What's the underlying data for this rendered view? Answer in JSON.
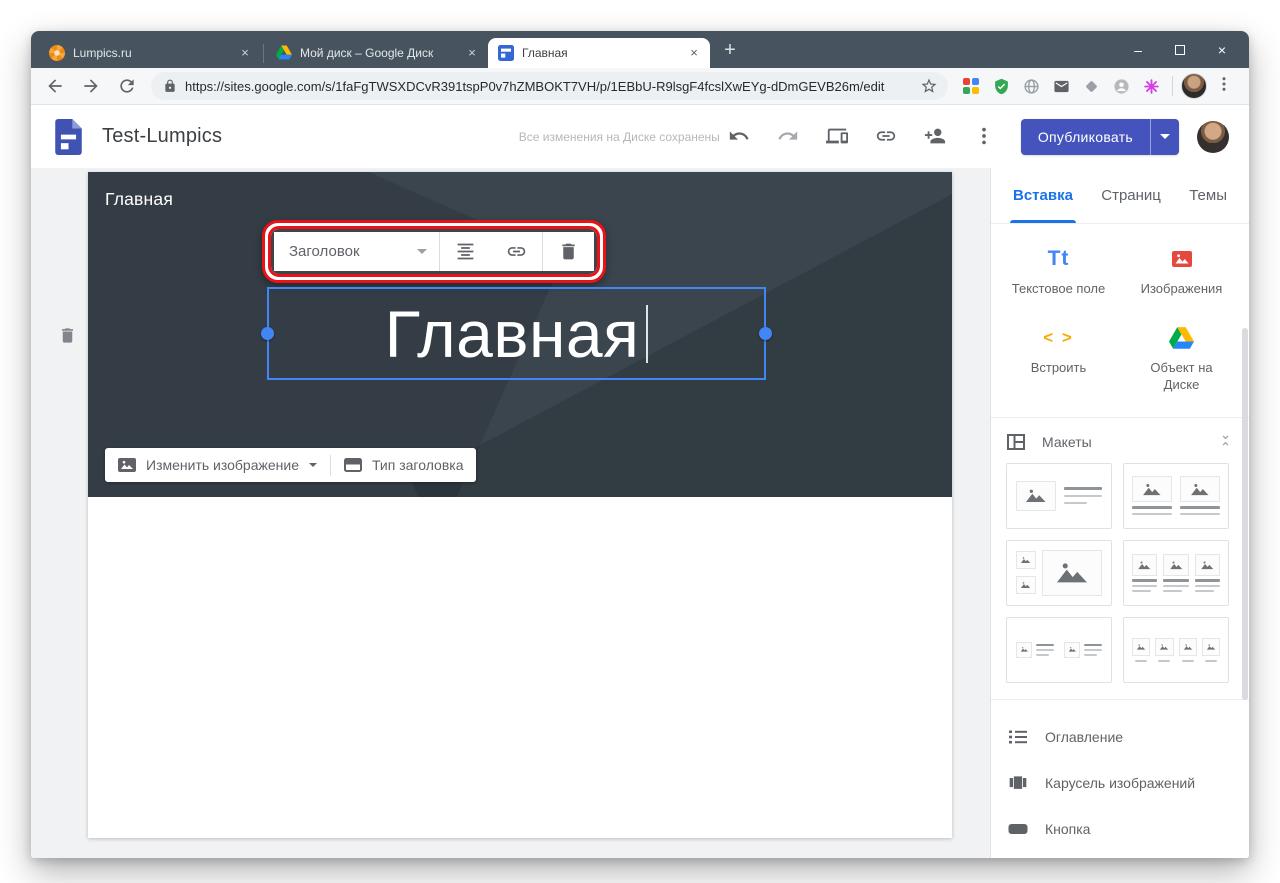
{
  "browser": {
    "tabs": [
      {
        "title": "Lumpics.ru",
        "icon": "lumpics-favicon",
        "close": "×"
      },
      {
        "title": "Мой диск – Google Диск",
        "icon": "drive-favicon",
        "close": "×"
      },
      {
        "title": "Главная",
        "icon": "sites-favicon",
        "close": "×"
      }
    ],
    "new_tab": "+",
    "controls": {
      "minimize": "–",
      "close": "×"
    },
    "url": "https://sites.google.com/s/1faFgTWSXDCvR391tspP0v7hZMBOKT7VH/p/1EBbU-R9lsgF4fcslXwEYg-dDmGEVB26m/edit"
  },
  "app": {
    "title": "Test-Lumpics",
    "status": "Все изменения на Диске сохранены",
    "publish": "Опубликовать"
  },
  "editor": {
    "page_label": "Главная",
    "title_text": "Главная",
    "toolbar": {
      "style_name": "Заголовок"
    },
    "change_image": "Изменить изображение",
    "header_type": "Тип заголовка"
  },
  "sidebar": {
    "tabs": [
      {
        "label": "Вставка",
        "active": true
      },
      {
        "label": "Страниц",
        "active": false
      },
      {
        "label": "Темы",
        "active": false
      }
    ],
    "insert": [
      {
        "label": "Текстовое поле",
        "icon": "text-field-icon",
        "glyph": "Tt"
      },
      {
        "label": "Изображения",
        "icon": "images-icon"
      },
      {
        "label": "Встроить",
        "icon": "embed-icon",
        "glyph": "< >"
      },
      {
        "label": "Объект на Диске",
        "icon": "drive-object-icon"
      }
    ],
    "layouts_title": "Макеты",
    "items": [
      {
        "label": "Оглавление",
        "icon": "toc-icon"
      },
      {
        "label": "Карусель изображений",
        "icon": "carousel-icon"
      },
      {
        "label": "Кнопка",
        "icon": "button-icon"
      }
    ]
  },
  "colors": {
    "publish_button": "#4454bc",
    "accent_blue": "#1a73e8",
    "annotation_red": "#ea1117",
    "banner_dark": "#3a454d",
    "selection_blue": "#4285f4",
    "tabbar_slate": "#47545f"
  }
}
